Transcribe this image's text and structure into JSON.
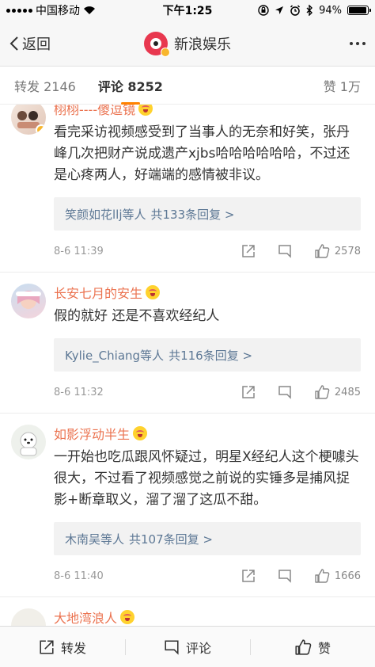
{
  "status": {
    "carrier": "中国移动",
    "time": "下午1:25",
    "battery_text": "94%",
    "battery_level": 0.94
  },
  "nav": {
    "back_label": "返回",
    "title": "新浪娱乐"
  },
  "tabs": [
    {
      "label": "转发 2146"
    },
    {
      "label": "评论 8252"
    },
    {
      "label": "赞 1万"
    }
  ],
  "comments": [
    {
      "username": "栩栩----傻逗镜",
      "text": "看完采访视频感受到了当事人的无奈和好笑，张丹峰几次把财产说成遗产xjbs哈哈哈哈哈哈，不过还是心疼两人，好端端的感情被非议。",
      "reply_users": "笑颜如花llj等人",
      "reply_count": "共133条回复 >",
      "time": "8-6 11:39",
      "likes": "2578"
    },
    {
      "username": "长安七月的安生",
      "text": "假的就好 还是不喜欢经纪人",
      "reply_users": "Kylie_Chiang等人",
      "reply_count": "共116条回复 >",
      "time": "8-6 11:32",
      "likes": "2485"
    },
    {
      "username": "如影浮动半生",
      "text": "一开始也吃瓜跟风怀疑过，明星X经纪人这个梗噱头很大，不过看了视频感觉之前说的实锤多是捕风捉影+断章取义，溜了溜了这瓜不甜。",
      "reply_users": "木南吴等人",
      "reply_count": "共107条回复 >",
      "time": "8-6 11:40",
      "likes": "1666"
    },
    {
      "username": "大地湾浪人"
    }
  ],
  "bottom": {
    "repost_label": "转发",
    "comment_label": "评论",
    "like_label": "赞"
  },
  "colors": {
    "username": "#eb7350",
    "reply_link": "#5d7895",
    "accent": "#ff8200"
  }
}
